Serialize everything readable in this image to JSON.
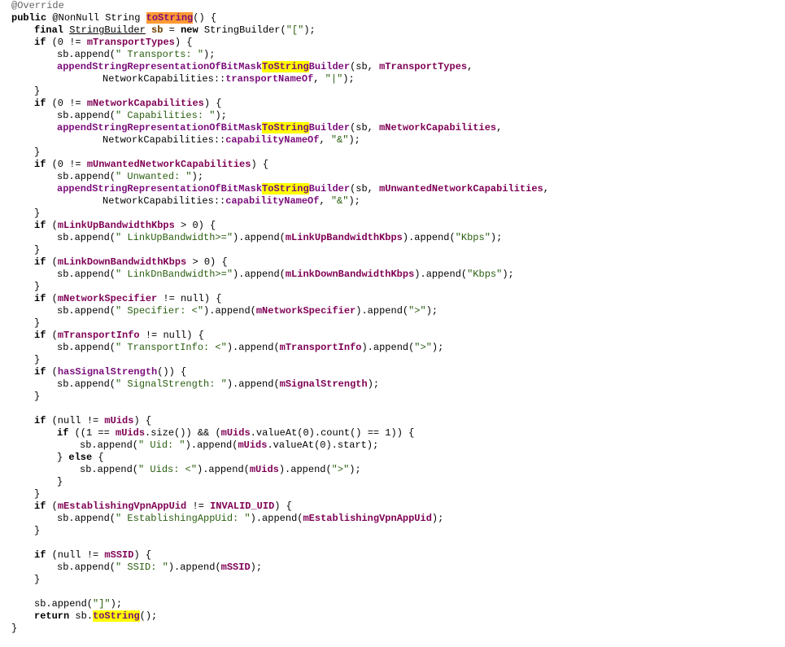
{
  "lines": [
    {
      "indent": 0,
      "tokens": [
        {
          "t": "@Override",
          "c": "ann"
        }
      ]
    },
    {
      "indent": 0,
      "tokens": [
        {
          "t": "public",
          "c": "kw"
        },
        {
          "t": " @NonNull String ",
          "c": "plain"
        },
        {
          "t": "toString",
          "c": "method",
          "hl": "orange"
        },
        {
          "t": "() {",
          "c": "plain"
        }
      ]
    },
    {
      "indent": 1,
      "tokens": [
        {
          "t": "final",
          "c": "kw"
        },
        {
          "t": " ",
          "c": "plain"
        },
        {
          "t": "StringBuilder",
          "c": "type-ul"
        },
        {
          "t": " ",
          "c": "plain"
        },
        {
          "t": "sb",
          "c": "local"
        },
        {
          "t": " = ",
          "c": "plain"
        },
        {
          "t": "new",
          "c": "kw"
        },
        {
          "t": " StringBuilder(",
          "c": "plain"
        },
        {
          "t": "\"[\"",
          "c": "str"
        },
        {
          "t": ");",
          "c": "plain"
        }
      ]
    },
    {
      "indent": 1,
      "tokens": [
        {
          "t": "if",
          "c": "kw"
        },
        {
          "t": " (0 != ",
          "c": "plain"
        },
        {
          "t": "mTransportTypes",
          "c": "field"
        },
        {
          "t": ") {",
          "c": "plain"
        }
      ]
    },
    {
      "indent": 2,
      "tokens": [
        {
          "t": "sb.append(",
          "c": "plain"
        },
        {
          "t": "\" Transports: \"",
          "c": "str"
        },
        {
          "t": ");",
          "c": "plain"
        }
      ]
    },
    {
      "indent": 2,
      "tokens": [
        {
          "t": "appendStringRepresentationOfBitMask",
          "c": "method"
        },
        {
          "t": "ToString",
          "c": "method",
          "hl": "yellow"
        },
        {
          "t": "Builder",
          "c": "method"
        },
        {
          "t": "(sb, ",
          "c": "plain"
        },
        {
          "t": "mTransportTypes",
          "c": "field"
        },
        {
          "t": ",",
          "c": "plain"
        }
      ]
    },
    {
      "indent": 4,
      "tokens": [
        {
          "t": "NetworkCapabilities::",
          "c": "plain"
        },
        {
          "t": "transportNameOf",
          "c": "method"
        },
        {
          "t": ", ",
          "c": "plain"
        },
        {
          "t": "\"|\"",
          "c": "str"
        },
        {
          "t": ");",
          "c": "plain"
        }
      ]
    },
    {
      "indent": 1,
      "tokens": [
        {
          "t": "}",
          "c": "plain"
        }
      ]
    },
    {
      "indent": 1,
      "tokens": [
        {
          "t": "if",
          "c": "kw"
        },
        {
          "t": " (0 != ",
          "c": "plain"
        },
        {
          "t": "mNetworkCapabilities",
          "c": "field"
        },
        {
          "t": ") {",
          "c": "plain"
        }
      ]
    },
    {
      "indent": 2,
      "tokens": [
        {
          "t": "sb.append(",
          "c": "plain"
        },
        {
          "t": "\" Capabilities: \"",
          "c": "str"
        },
        {
          "t": ");",
          "c": "plain"
        }
      ]
    },
    {
      "indent": 2,
      "tokens": [
        {
          "t": "appendStringRepresentationOfBitMask",
          "c": "method"
        },
        {
          "t": "ToString",
          "c": "method",
          "hl": "yellow"
        },
        {
          "t": "Builder",
          "c": "method"
        },
        {
          "t": "(sb, ",
          "c": "plain"
        },
        {
          "t": "mNetworkCapabilities",
          "c": "field"
        },
        {
          "t": ",",
          "c": "plain"
        }
      ]
    },
    {
      "indent": 4,
      "tokens": [
        {
          "t": "NetworkCapabilities::",
          "c": "plain"
        },
        {
          "t": "capabilityNameOf",
          "c": "method"
        },
        {
          "t": ", ",
          "c": "plain"
        },
        {
          "t": "\"&\"",
          "c": "str"
        },
        {
          "t": ");",
          "c": "plain"
        }
      ]
    },
    {
      "indent": 1,
      "tokens": [
        {
          "t": "}",
          "c": "plain"
        }
      ]
    },
    {
      "indent": 1,
      "tokens": [
        {
          "t": "if",
          "c": "kw"
        },
        {
          "t": " (0 != ",
          "c": "plain"
        },
        {
          "t": "mUnwantedNetworkCapabilities",
          "c": "field"
        },
        {
          "t": ") {",
          "c": "plain"
        }
      ]
    },
    {
      "indent": 2,
      "tokens": [
        {
          "t": "sb.append(",
          "c": "plain"
        },
        {
          "t": "\" Unwanted: \"",
          "c": "str"
        },
        {
          "t": ");",
          "c": "plain"
        }
      ]
    },
    {
      "indent": 2,
      "tokens": [
        {
          "t": "appendStringRepresentationOfBitMask",
          "c": "method"
        },
        {
          "t": "ToString",
          "c": "method",
          "hl": "yellow"
        },
        {
          "t": "Builder",
          "c": "method"
        },
        {
          "t": "(sb, ",
          "c": "plain"
        },
        {
          "t": "mUnwantedNetworkCapabilities",
          "c": "field"
        },
        {
          "t": ",",
          "c": "plain"
        }
      ]
    },
    {
      "indent": 4,
      "tokens": [
        {
          "t": "NetworkCapabilities::",
          "c": "plain"
        },
        {
          "t": "capabilityNameOf",
          "c": "method"
        },
        {
          "t": ", ",
          "c": "plain"
        },
        {
          "t": "\"&\"",
          "c": "str"
        },
        {
          "t": ");",
          "c": "plain"
        }
      ]
    },
    {
      "indent": 1,
      "tokens": [
        {
          "t": "}",
          "c": "plain"
        }
      ]
    },
    {
      "indent": 1,
      "tokens": [
        {
          "t": "if",
          "c": "kw"
        },
        {
          "t": " (",
          "c": "plain"
        },
        {
          "t": "mLinkUpBandwidthKbps",
          "c": "field"
        },
        {
          "t": " > 0) {",
          "c": "plain"
        }
      ]
    },
    {
      "indent": 2,
      "tokens": [
        {
          "t": "sb.append(",
          "c": "plain"
        },
        {
          "t": "\" LinkUpBandwidth>=\"",
          "c": "str"
        },
        {
          "t": ").append(",
          "c": "plain"
        },
        {
          "t": "mLinkUpBandwidthKbps",
          "c": "field"
        },
        {
          "t": ").append(",
          "c": "plain"
        },
        {
          "t": "\"Kbps\"",
          "c": "str"
        },
        {
          "t": ");",
          "c": "plain"
        }
      ]
    },
    {
      "indent": 1,
      "tokens": [
        {
          "t": "}",
          "c": "plain"
        }
      ]
    },
    {
      "indent": 1,
      "tokens": [
        {
          "t": "if",
          "c": "kw"
        },
        {
          "t": " (",
          "c": "plain"
        },
        {
          "t": "mLinkDownBandwidthKbps",
          "c": "field"
        },
        {
          "t": " > 0) {",
          "c": "plain"
        }
      ]
    },
    {
      "indent": 2,
      "tokens": [
        {
          "t": "sb.append(",
          "c": "plain"
        },
        {
          "t": "\" LinkDnBandwidth>=\"",
          "c": "str"
        },
        {
          "t": ").append(",
          "c": "plain"
        },
        {
          "t": "mLinkDownBandwidthKbps",
          "c": "field"
        },
        {
          "t": ").append(",
          "c": "plain"
        },
        {
          "t": "\"Kbps\"",
          "c": "str"
        },
        {
          "t": ");",
          "c": "plain"
        }
      ]
    },
    {
      "indent": 1,
      "tokens": [
        {
          "t": "}",
          "c": "plain"
        }
      ]
    },
    {
      "indent": 1,
      "tokens": [
        {
          "t": "if",
          "c": "kw"
        },
        {
          "t": " (",
          "c": "plain"
        },
        {
          "t": "mNetworkSpecifier",
          "c": "field"
        },
        {
          "t": " != null) {",
          "c": "plain"
        }
      ]
    },
    {
      "indent": 2,
      "tokens": [
        {
          "t": "sb.append(",
          "c": "plain"
        },
        {
          "t": "\" Specifier: <\"",
          "c": "str"
        },
        {
          "t": ").append(",
          "c": "plain"
        },
        {
          "t": "mNetworkSpecifier",
          "c": "field"
        },
        {
          "t": ").append(",
          "c": "plain"
        },
        {
          "t": "\">\"",
          "c": "str"
        },
        {
          "t": ");",
          "c": "plain"
        }
      ]
    },
    {
      "indent": 1,
      "tokens": [
        {
          "t": "}",
          "c": "plain"
        }
      ]
    },
    {
      "indent": 1,
      "tokens": [
        {
          "t": "if",
          "c": "kw"
        },
        {
          "t": " (",
          "c": "plain"
        },
        {
          "t": "mTransportInfo",
          "c": "field"
        },
        {
          "t": " != null) {",
          "c": "plain"
        }
      ]
    },
    {
      "indent": 2,
      "tokens": [
        {
          "t": "sb.append(",
          "c": "plain"
        },
        {
          "t": "\" TransportInfo: <\"",
          "c": "str"
        },
        {
          "t": ").append(",
          "c": "plain"
        },
        {
          "t": "mTransportInfo",
          "c": "field"
        },
        {
          "t": ").append(",
          "c": "plain"
        },
        {
          "t": "\">\"",
          "c": "str"
        },
        {
          "t": ");",
          "c": "plain"
        }
      ]
    },
    {
      "indent": 1,
      "tokens": [
        {
          "t": "}",
          "c": "plain"
        }
      ]
    },
    {
      "indent": 1,
      "tokens": [
        {
          "t": "if",
          "c": "kw"
        },
        {
          "t": " (",
          "c": "plain"
        },
        {
          "t": "hasSignalStrength",
          "c": "method"
        },
        {
          "t": "()) {",
          "c": "plain"
        }
      ]
    },
    {
      "indent": 2,
      "tokens": [
        {
          "t": "sb.append(",
          "c": "plain"
        },
        {
          "t": "\" SignalStrength: \"",
          "c": "str"
        },
        {
          "t": ").append(",
          "c": "plain"
        },
        {
          "t": "mSignalStrength",
          "c": "field"
        },
        {
          "t": ");",
          "c": "plain"
        }
      ]
    },
    {
      "indent": 1,
      "tokens": [
        {
          "t": "}",
          "c": "plain"
        }
      ]
    },
    {
      "indent": 0,
      "tokens": []
    },
    {
      "indent": 1,
      "tokens": [
        {
          "t": "if",
          "c": "kw"
        },
        {
          "t": " (null != ",
          "c": "plain"
        },
        {
          "t": "mUids",
          "c": "field"
        },
        {
          "t": ") {",
          "c": "plain"
        }
      ]
    },
    {
      "indent": 2,
      "tokens": [
        {
          "t": "if",
          "c": "kw"
        },
        {
          "t": " ((1 == ",
          "c": "plain"
        },
        {
          "t": "mUids",
          "c": "field"
        },
        {
          "t": ".size()) && (",
          "c": "plain"
        },
        {
          "t": "mUids",
          "c": "field"
        },
        {
          "t": ".valueAt(0).count() == 1)) {",
          "c": "plain"
        }
      ]
    },
    {
      "indent": 3,
      "tokens": [
        {
          "t": "sb.append(",
          "c": "plain"
        },
        {
          "t": "\" Uid: \"",
          "c": "str"
        },
        {
          "t": ").append(",
          "c": "plain"
        },
        {
          "t": "mUids",
          "c": "field"
        },
        {
          "t": ".valueAt(0).start);",
          "c": "plain"
        }
      ]
    },
    {
      "indent": 2,
      "tokens": [
        {
          "t": "} ",
          "c": "plain"
        },
        {
          "t": "else",
          "c": "kw"
        },
        {
          "t": " {",
          "c": "plain"
        }
      ]
    },
    {
      "indent": 3,
      "tokens": [
        {
          "t": "sb.append(",
          "c": "plain"
        },
        {
          "t": "\" Uids: <\"",
          "c": "str"
        },
        {
          "t": ").append(",
          "c": "plain"
        },
        {
          "t": "mUids",
          "c": "field"
        },
        {
          "t": ").append(",
          "c": "plain"
        },
        {
          "t": "\">\"",
          "c": "str"
        },
        {
          "t": ");",
          "c": "plain"
        }
      ]
    },
    {
      "indent": 2,
      "tokens": [
        {
          "t": "}",
          "c": "plain"
        }
      ]
    },
    {
      "indent": 1,
      "tokens": [
        {
          "t": "}",
          "c": "plain"
        }
      ]
    },
    {
      "indent": 1,
      "tokens": [
        {
          "t": "if",
          "c": "kw"
        },
        {
          "t": " (",
          "c": "plain"
        },
        {
          "t": "mEstablishingVpnAppUid",
          "c": "field"
        },
        {
          "t": " != ",
          "c": "plain"
        },
        {
          "t": "INVALID_UID",
          "c": "field"
        },
        {
          "t": ") {",
          "c": "plain"
        }
      ]
    },
    {
      "indent": 2,
      "tokens": [
        {
          "t": "sb.append(",
          "c": "plain"
        },
        {
          "t": "\" EstablishingAppUid: \"",
          "c": "str"
        },
        {
          "t": ").append(",
          "c": "plain"
        },
        {
          "t": "mEstablishingVpnAppUid",
          "c": "field"
        },
        {
          "t": ");",
          "c": "plain"
        }
      ]
    },
    {
      "indent": 1,
      "tokens": [
        {
          "t": "}",
          "c": "plain"
        }
      ]
    },
    {
      "indent": 0,
      "tokens": []
    },
    {
      "indent": 1,
      "tokens": [
        {
          "t": "if",
          "c": "kw"
        },
        {
          "t": " (null != ",
          "c": "plain"
        },
        {
          "t": "mSSID",
          "c": "field"
        },
        {
          "t": ") {",
          "c": "plain"
        }
      ]
    },
    {
      "indent": 2,
      "tokens": [
        {
          "t": "sb.append(",
          "c": "plain"
        },
        {
          "t": "\" SSID: \"",
          "c": "str"
        },
        {
          "t": ").append(",
          "c": "plain"
        },
        {
          "t": "mSSID",
          "c": "field"
        },
        {
          "t": ");",
          "c": "plain"
        }
      ]
    },
    {
      "indent": 1,
      "tokens": [
        {
          "t": "}",
          "c": "plain"
        }
      ]
    },
    {
      "indent": 0,
      "tokens": []
    },
    {
      "indent": 1,
      "tokens": [
        {
          "t": "sb.append(",
          "c": "plain"
        },
        {
          "t": "\"]\"",
          "c": "str"
        },
        {
          "t": ");",
          "c": "plain"
        }
      ]
    },
    {
      "indent": 1,
      "tokens": [
        {
          "t": "return",
          "c": "kw"
        },
        {
          "t": " sb.",
          "c": "plain"
        },
        {
          "t": "toString",
          "c": "method",
          "hl": "yellow"
        },
        {
          "t": "();",
          "c": "plain"
        }
      ]
    },
    {
      "indent": 0,
      "tokens": [
        {
          "t": "}",
          "c": "plain"
        }
      ]
    }
  ],
  "colors": {
    "background": "#ffffff",
    "highlight_primary": "#ff9933",
    "highlight_secondary": "#ffff00",
    "field": "#7f0055",
    "string": "#2a5e10"
  }
}
